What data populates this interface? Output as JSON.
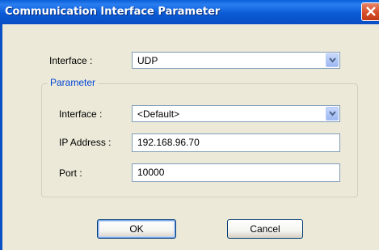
{
  "window": {
    "title": "Communication Interface Parameter"
  },
  "interface": {
    "label": "Interface :",
    "value": "UDP"
  },
  "parameter_group": {
    "legend": "Parameter",
    "interface": {
      "label": "Interface :",
      "value": "<Default>"
    },
    "ip_address": {
      "label": "IP Address :",
      "value": "192.168.96.70"
    },
    "port": {
      "label": "Port :",
      "value": "10000"
    }
  },
  "buttons": {
    "ok_label": "OK",
    "cancel_label": "Cancel"
  },
  "icons": {
    "close": "close-icon",
    "dropdown": "chevron-down-icon"
  },
  "colors": {
    "titlebar": "#0a5fd8",
    "dialog_background": "#ece9d8",
    "group_legend": "#0046d5",
    "close_button": "#d9512c",
    "field_border": "#7f9db9"
  }
}
